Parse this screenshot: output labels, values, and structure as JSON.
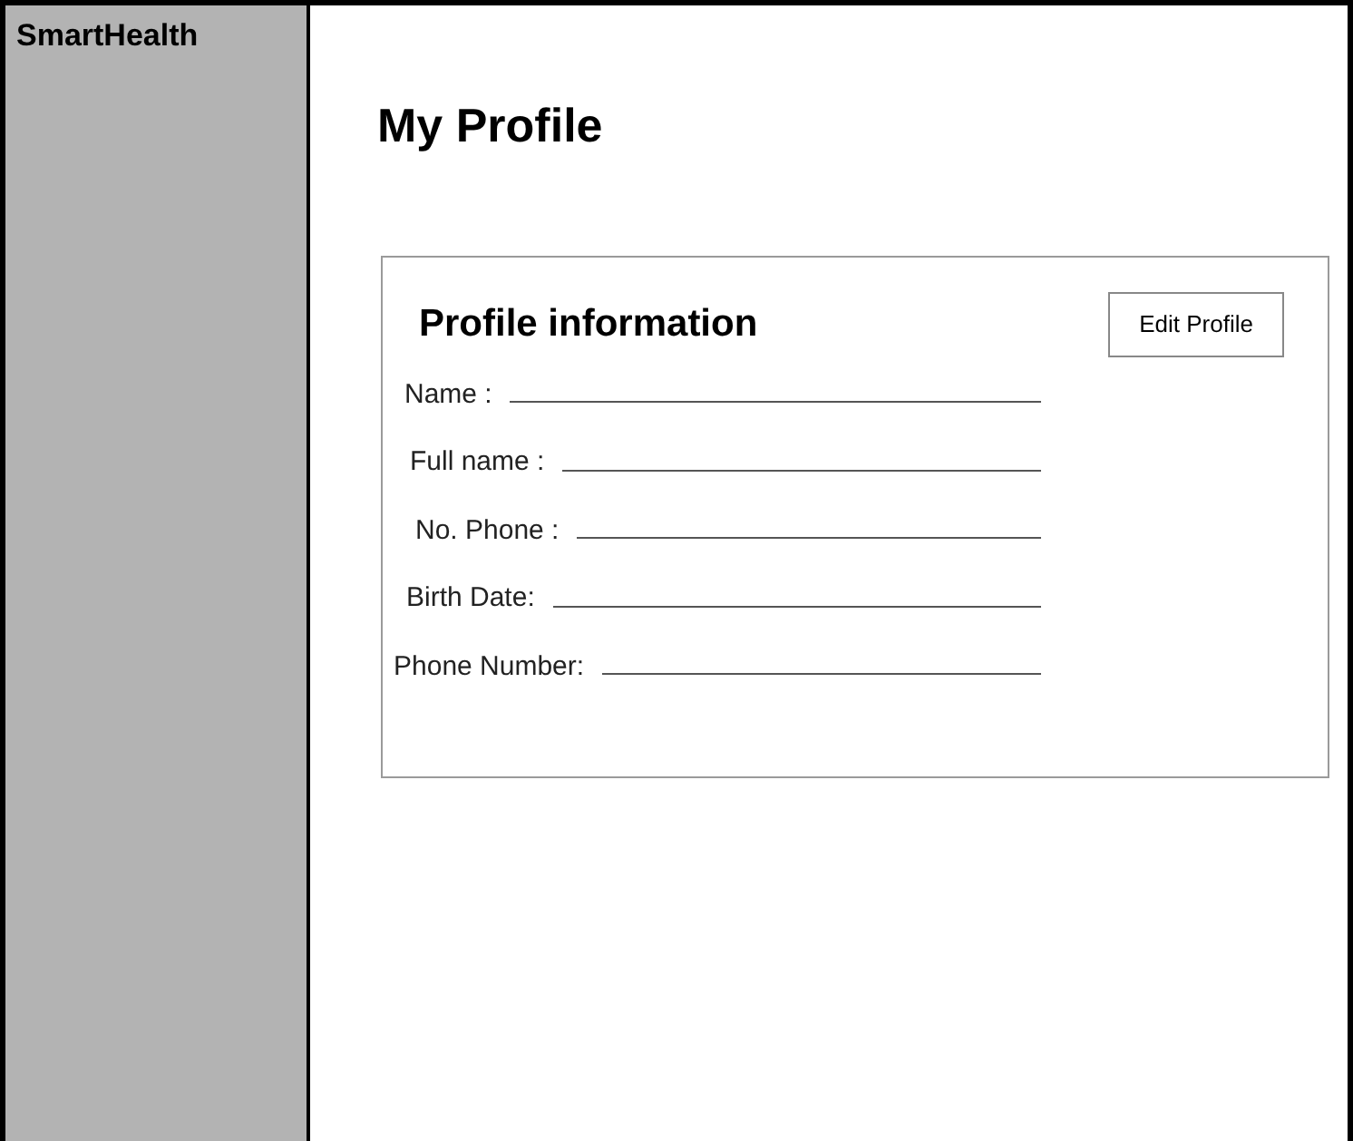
{
  "sidebar": {
    "title": "SmartHealth"
  },
  "page": {
    "title": "My Profile"
  },
  "card": {
    "title": "Profile information",
    "button": "Edit Profile",
    "fields": [
      {
        "label": "Name :"
      },
      {
        "label": "Full name :"
      },
      {
        "label": "No. Phone :"
      },
      {
        "label": "Birth Date:"
      },
      {
        "label": "Phone Number:"
      }
    ]
  }
}
